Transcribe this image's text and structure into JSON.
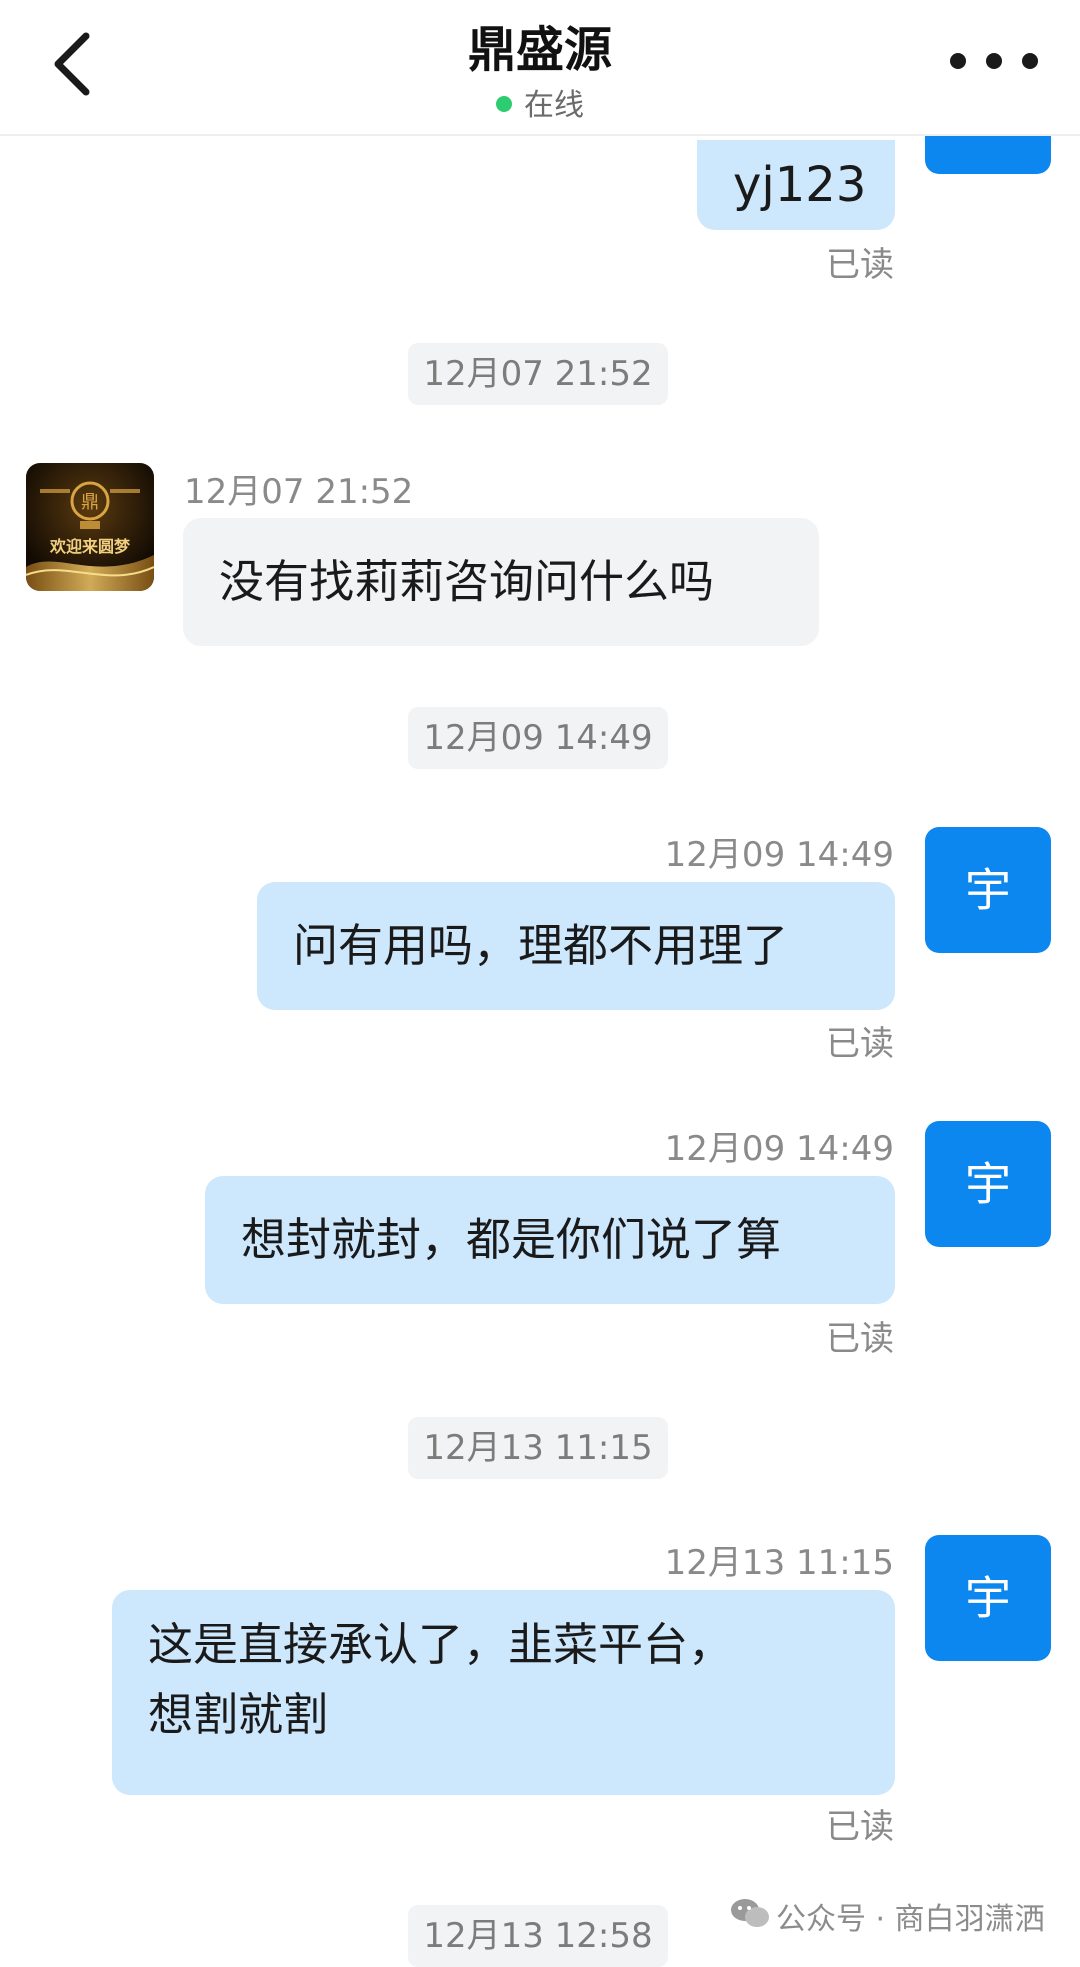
{
  "header": {
    "title": "鼎盛源",
    "status": "在线"
  },
  "messages": {
    "m0": {
      "text": "yj123",
      "read": "已读"
    },
    "d1": "12月07 21:52",
    "m1": {
      "time": "12月07 21:52",
      "text": "没有找莉莉咨询问什么吗"
    },
    "d2": "12月09 14:49",
    "m2": {
      "time": "12月09 14:49",
      "avatar": "宇",
      "text": "问有用吗，理都不用理了",
      "read": "已读"
    },
    "m3": {
      "time": "12月09 14:49",
      "avatar": "宇",
      "text": "想封就封，都是你们说了算",
      "read": "已读"
    },
    "d3": "12月13 11:15",
    "m4": {
      "time": "12月13 11:15",
      "avatar": "宇",
      "line1": "这是直接承认了，韭菜平台，",
      "line2": "想割就割",
      "read": "已读"
    },
    "d4": "12月13 12:58"
  },
  "brand_avatar": {
    "caption": "欢迎来圆梦",
    "colors": {
      "bg": "#1b1206",
      "gold": "#d9a441"
    }
  },
  "watermark": {
    "text": "公众号 · 商白羽潇洒"
  },
  "colors": {
    "outgoing_bubble": "#cde7fd",
    "incoming_bubble": "#f2f3f5",
    "user_avatar": "#0d87f0",
    "online_dot": "#2ecc71"
  },
  "icons": [
    "back-arrow-icon",
    "more-dots-icon",
    "wechat-icon"
  ]
}
